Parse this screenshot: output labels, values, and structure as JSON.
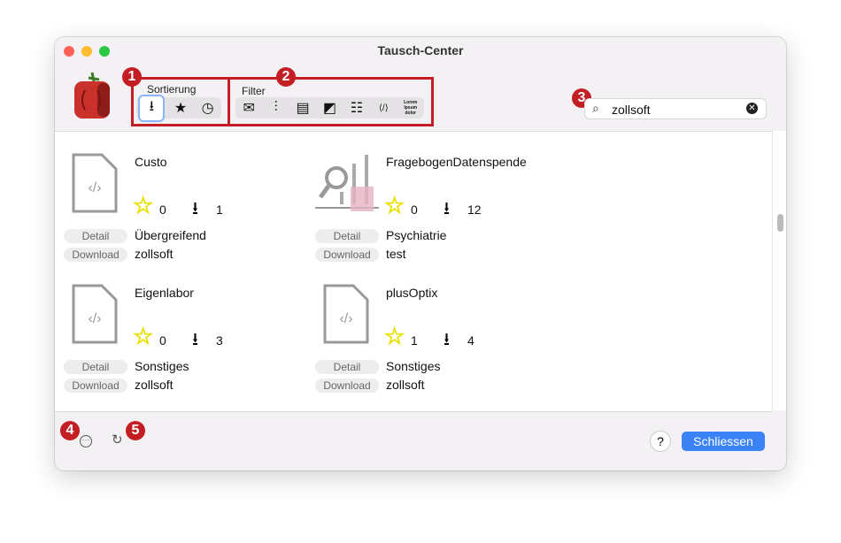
{
  "window": {
    "title": "Tausch-Center"
  },
  "toolbar": {
    "sort_label": "Sortierung",
    "sort_options": [
      "download-icon",
      "star-icon",
      "clock-icon"
    ],
    "sort_selected": "download-icon",
    "filter_label": "Filter",
    "filter_options": [
      "mail-icon",
      "analytics-icon",
      "document-icon",
      "folder-edit-icon",
      "checklist-icon",
      "code-file-icon",
      "lorem-text-icon"
    ],
    "lorem_text": "Lorem Ipsum dolor",
    "search": {
      "value": "zollsoft"
    }
  },
  "markers": [
    "1",
    "2",
    "3",
    "4",
    "5"
  ],
  "items": [
    {
      "name": "Custo",
      "icon": "code-file-icon",
      "stars": "0",
      "downloads": "1",
      "category": "Übergreifend",
      "author": "zollsoft"
    },
    {
      "name": "FragebogenDatenspende",
      "icon": "sql-analytics-icon",
      "stars": "0",
      "downloads": "12",
      "category": "Psychiatrie",
      "author": "test"
    },
    {
      "name": "Eigenlabor",
      "icon": "code-file-icon",
      "stars": "0",
      "downloads": "3",
      "category": "Sonstiges",
      "author": "zollsoft"
    },
    {
      "name": "plusOptix",
      "icon": "code-file-icon",
      "stars": "1",
      "downloads": "4",
      "category": "Sonstiges",
      "author": "zollsoft"
    }
  ],
  "buttons": {
    "detail": "Detail",
    "download": "Download",
    "help": "?",
    "close": "Schliessen"
  },
  "colors": {
    "accent": "#3b82f6",
    "marker": "#c41e25",
    "star": "#f4ef2a"
  }
}
